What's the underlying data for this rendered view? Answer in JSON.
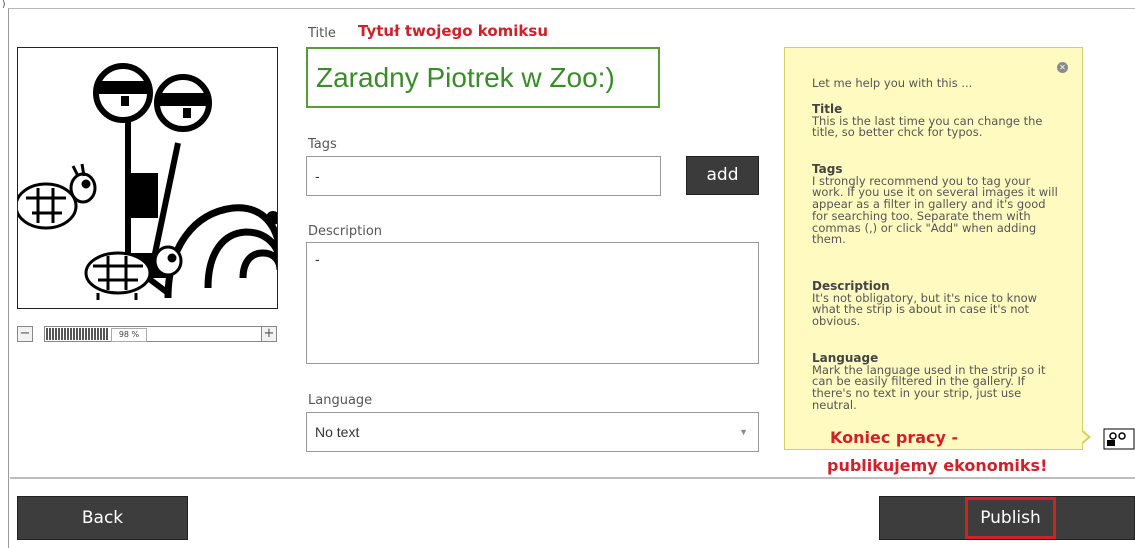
{
  "top_mark": ")",
  "title_section": {
    "label": "Title",
    "callout": "Tytuł twojego komiksu",
    "value": "Zaradny Piotrek w Zoo:)"
  },
  "tags": {
    "label": "Tags",
    "value": "-",
    "add_label": "add"
  },
  "description": {
    "label": "Description",
    "value": "-"
  },
  "language": {
    "label": "Language",
    "selected": "No text"
  },
  "zoom": {
    "minus": "−",
    "plus": "+",
    "value_text": "98 %",
    "level": 0.98
  },
  "help": {
    "intro": "Let me help you with this ...",
    "sections": [
      {
        "heading": "Title",
        "text": "This is the last time you can change the title, so better chck for typos."
      },
      {
        "heading": "Tags",
        "text": "I strongly recommend you to tag your work. If you use it on several images it will appear as a filter in gallery and it's good for searching too. Separate them with commas (,) or click \"Add\" when adding them."
      },
      {
        "heading": "Description",
        "text": "It's not obligatory, but it's nice to know what the strip is about in case it's not obvious."
      },
      {
        "heading": "Language",
        "text": "Mark the language used in the strip so it can be easily filtered in the gallery. If there's no text in your strip, just use neutral."
      }
    ]
  },
  "callout_end": {
    "line1": "Koniec pracy -",
    "line2": "publikujemy ekonomiks!"
  },
  "buttons": {
    "back": "Back",
    "publish": "Publish"
  },
  "colors": {
    "callout_red": "#d0202a",
    "title_green": "#3a8c2a",
    "help_bg": "#fffbc0",
    "button_dark": "#3d3d3d"
  }
}
